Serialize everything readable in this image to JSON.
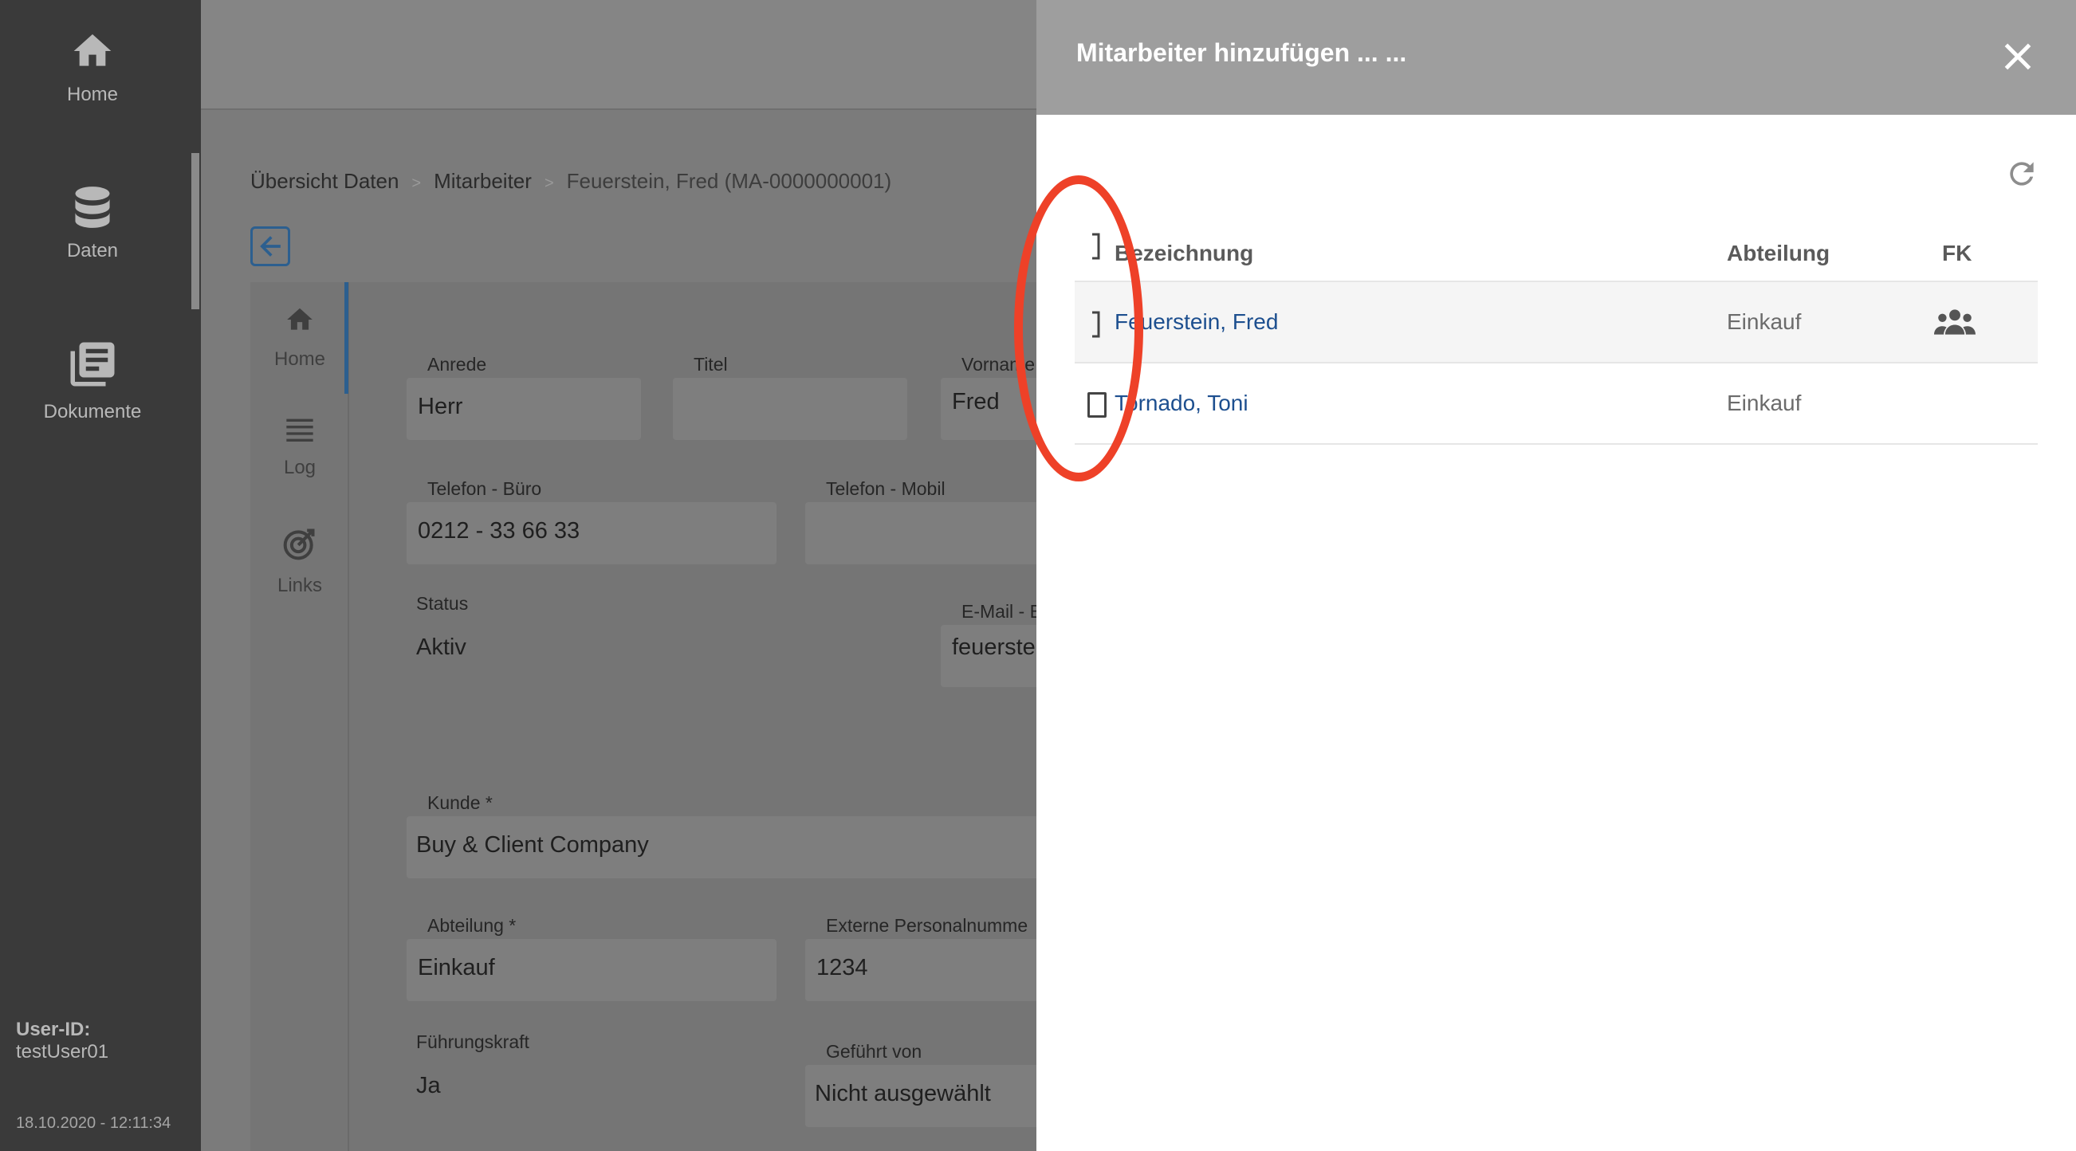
{
  "nav": {
    "items": [
      {
        "label": "Home",
        "icon": "home-icon"
      },
      {
        "label": "Daten",
        "icon": "database-icon"
      },
      {
        "label": "Dokumente",
        "icon": "documents-icon"
      }
    ],
    "user_label": "User-ID:",
    "user_id": "testUser01",
    "timestamp": "18.10.2020 - 12:11:34"
  },
  "breadcrumb": {
    "items": [
      "Übersicht Daten",
      "Mitarbeiter",
      "Feuerstein, Fred (MA-0000000001)"
    ],
    "separator": ">"
  },
  "subnav": {
    "items": [
      {
        "label": "Home",
        "icon": "home-icon"
      },
      {
        "label": "Log",
        "icon": "list-icon"
      },
      {
        "label": "Links",
        "icon": "target-icon"
      }
    ]
  },
  "form": {
    "anrede": {
      "label": "Anrede",
      "value": "Herr"
    },
    "titel": {
      "label": "Titel",
      "value": ""
    },
    "vorname": {
      "label": "Vorname",
      "value": "Fred"
    },
    "telefon_buero": {
      "label": "Telefon - Büro",
      "value": "0212 - 33 66 33"
    },
    "telefon_mobil": {
      "label": "Telefon - Mobil",
      "value": ""
    },
    "status": {
      "label": "Status",
      "value": "Aktiv"
    },
    "email": {
      "label": "E-Mail - B",
      "value": "feuerste"
    },
    "kunde": {
      "label": "Kunde *",
      "value": "Buy & Client Company"
    },
    "abteilung": {
      "label": "Abteilung *",
      "value": "Einkauf"
    },
    "externe_personalnummer": {
      "label": "Externe Personalnumme",
      "value": "1234"
    },
    "fuehrungskraft": {
      "label": "Führungskraft",
      "value": "Ja"
    },
    "gefuehrt_von": {
      "label": "Geführt von",
      "value": "Nicht ausgewählt"
    }
  },
  "drawer": {
    "title": "Mitarbeiter hinzufügen ... ...",
    "columns": [
      "Bezeichnung",
      "Abteilung",
      "FK"
    ],
    "rows": [
      {
        "name": "Feuerstein, Fred",
        "abteilung": "Einkauf",
        "fk_icon": "group-icon"
      },
      {
        "name": "Tornado, Toni",
        "abteilung": "Einkauf",
        "fk_icon": ""
      }
    ]
  },
  "colors": {
    "nav_bg": "#3a3a3a",
    "drawer_header": "#9e9e9e",
    "link": "#1d4f8f",
    "annotation": "#ee4128"
  }
}
